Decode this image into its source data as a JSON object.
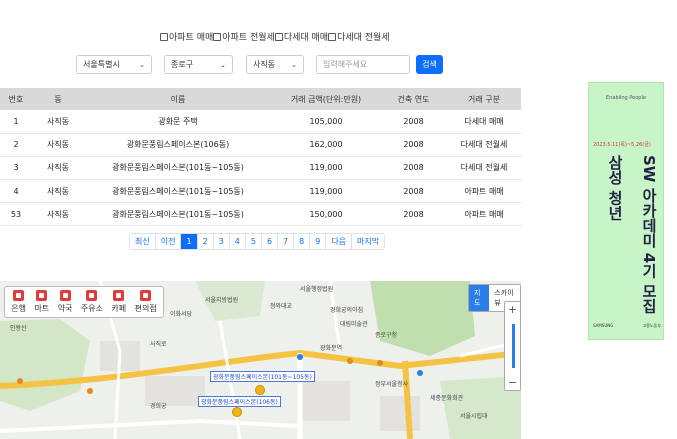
{
  "filters": [
    {
      "label": "아파트 매매"
    },
    {
      "label": "아파트 전월세"
    },
    {
      "label": "다세대 매매"
    },
    {
      "label": "다세대 전월세"
    }
  ],
  "search": {
    "city": "서울특별시",
    "district": "종로구",
    "dong": "사직동",
    "placeholder": "입력해주세요",
    "button": "검색"
  },
  "table": {
    "headers": [
      "번호",
      "동",
      "이름",
      "거래 금액(단위:만원)",
      "건축 연도",
      "거래 구분"
    ],
    "rows": [
      [
        "1",
        "사직동",
        "광화문 주택",
        "105,000",
        "2008",
        "다세대 매매"
      ],
      [
        "2",
        "사직동",
        "광화문풍림스페이스본(106동)",
        "162,000",
        "2008",
        "다세대 전월세"
      ],
      [
        "3",
        "사직동",
        "광화문풍림스페이스본(101동~105동)",
        "119,000",
        "2008",
        "다세대 전월세"
      ],
      [
        "4",
        "사직동",
        "광화문풍림스페이스본(101동~105동)",
        "119,000",
        "2008",
        "아파트 매매"
      ],
      [
        "53",
        "사직동",
        "광화문풍림스페이스본(101동~105동)",
        "150,000",
        "2008",
        "아파트 매매"
      ]
    ]
  },
  "pagination": {
    "first": "최신",
    "prev": "이전",
    "pages": [
      "1",
      "2",
      "3",
      "4",
      "5",
      "6",
      "7",
      "8",
      "9"
    ],
    "active": "1",
    "next": "다음",
    "last": "마지막"
  },
  "map": {
    "categories": [
      "은행",
      "마트",
      "약국",
      "주유소",
      "카페",
      "편의점"
    ],
    "map_type": [
      "지도",
      "스카이뷰"
    ],
    "zoom_in": "+",
    "zoom_out": "−",
    "labels": {
      "a": "서울행정법원",
      "b": "서울지방법원",
      "c": "경희궁의아침",
      "d": "대림미술관",
      "e": "종로구청",
      "f": "이화서당",
      "g": "청와대교",
      "h": "인왕산",
      "i": "세종문화회관",
      "j": "정부서울청사",
      "k": "서울시립대",
      "l": "사직로",
      "m": "경희궁",
      "n": "광화문역"
    },
    "marker1": "광화문풍림스페이스본(101동~105동)",
    "marker2": "광화문풍림스페이스본(106동)"
  },
  "ad": {
    "small_text": "Enabling People",
    "dates": "2023.5.11(목)~5.26(금)",
    "title_left": "삼성 청년",
    "title_right": "SW 아카데미 4기 모집",
    "footer_left": "SAMSUNG",
    "footer_right": "고용노동부"
  },
  "colors": {
    "primary": "#0d6efd",
    "header_bg": "#d9d9d9",
    "ad_bg": "#c8f5c8",
    "category_icon": "#e23b3b"
  }
}
